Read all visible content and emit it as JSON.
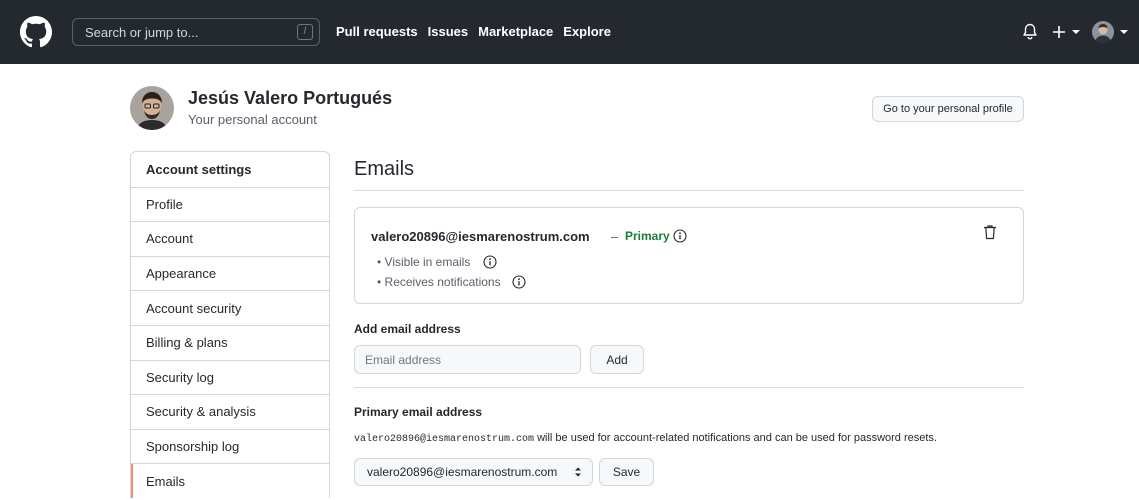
{
  "header": {
    "search_placeholder": "Search or jump to...",
    "search_shortcut": "/",
    "nav": [
      "Pull requests",
      "Issues",
      "Marketplace",
      "Explore"
    ],
    "icons": {
      "logo": "github-logo-icon",
      "bell": "bell-icon",
      "plus": "plus-icon",
      "avatar": "avatar"
    }
  },
  "profile": {
    "name": "Jesús Valero Portugués",
    "subtitle": "Your personal account",
    "go_to_profile": "Go to your personal profile"
  },
  "sidebar": {
    "items": [
      {
        "label": "Account settings",
        "heading": true
      },
      {
        "label": "Profile"
      },
      {
        "label": "Account"
      },
      {
        "label": "Appearance"
      },
      {
        "label": "Account security"
      },
      {
        "label": "Billing & plans"
      },
      {
        "label": "Security log"
      },
      {
        "label": "Security & analysis"
      },
      {
        "label": "Sponsorship log"
      },
      {
        "label": "Emails",
        "active": true
      }
    ]
  },
  "main": {
    "title": "Emails",
    "email": {
      "address": "valero20896@iesmarenostrum.com",
      "dash": "–",
      "primary_badge": "Primary",
      "bullets": [
        "• Visible in emails",
        "• Receives notifications"
      ]
    },
    "add_email": {
      "label": "Add email address",
      "placeholder": "Email address",
      "button": "Add"
    },
    "primary_email": {
      "label": "Primary email address",
      "desc_email": "valero20896@iesmarenostrum.com",
      "desc_text": " will be used for account-related notifications and can be used for password resets.",
      "selected": "valero20896@iesmarenostrum.com",
      "button": "Save"
    }
  },
  "colors": {
    "header_bg": "#24292f",
    "primary_green": "#1a7f37",
    "active_accent": "#fd8c73",
    "border": "#d0d7de"
  }
}
